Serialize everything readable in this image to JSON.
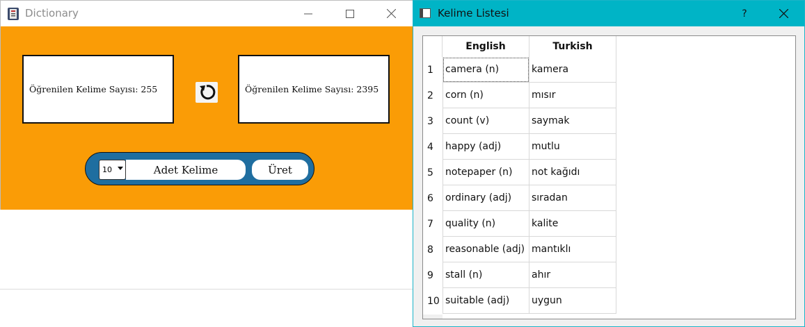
{
  "dictionary_window": {
    "title": "Dictionary",
    "learned_left": "Öğrenilen Kelime Sayısı: 255",
    "learned_right": "Öğrenilen Kelime Sayısı: 2395",
    "count_value": "10",
    "count_label": "Adet Kelime",
    "generate_label": "Üret",
    "colors": {
      "background": "#fa9c06",
      "pill": "#1f6ea0"
    }
  },
  "word_list_window": {
    "title": "Kelime Listesi",
    "help_label": "?",
    "columns": [
      "English",
      "Turkish"
    ],
    "rows": [
      {
        "num": "1",
        "english": "camera (n)",
        "turkish": "kamera"
      },
      {
        "num": "2",
        "english": "corn (n)",
        "turkish": "mısır"
      },
      {
        "num": "3",
        "english": "count (v)",
        "turkish": "saymak"
      },
      {
        "num": "4",
        "english": "happy (adj)",
        "turkish": "mutlu"
      },
      {
        "num": "5",
        "english": "notepaper (n)",
        "turkish": "not kağıdı"
      },
      {
        "num": "6",
        "english": "ordinary (adj)",
        "turkish": "sıradan"
      },
      {
        "num": "7",
        "english": "quality (n)",
        "turkish": "kalite"
      },
      {
        "num": "8",
        "english": "reasonable (adj)",
        "turkish": "mantıklı"
      },
      {
        "num": "9",
        "english": "stall (n)",
        "turkish": "ahır"
      },
      {
        "num": "10",
        "english": "suitable (adj)",
        "turkish": "uygun"
      }
    ],
    "colors": {
      "titlebar": "#00b4c6"
    }
  }
}
